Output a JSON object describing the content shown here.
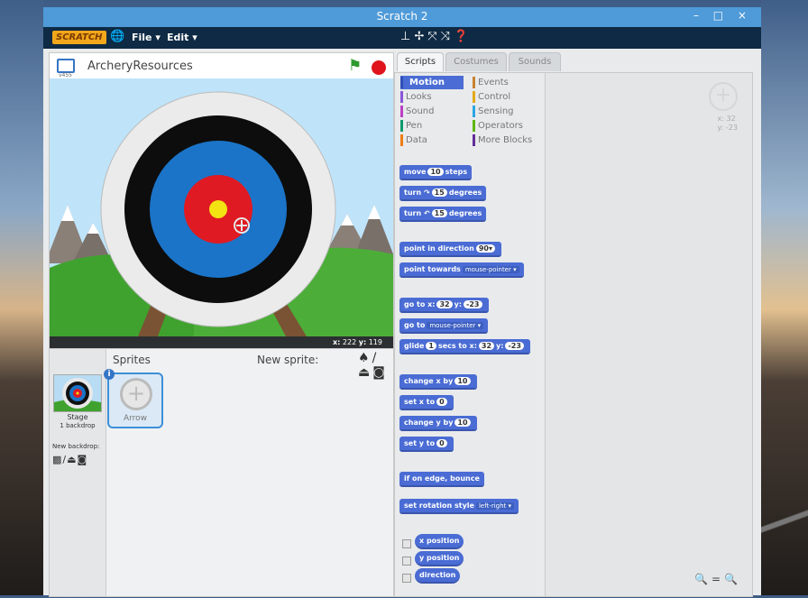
{
  "window": {
    "title": "Scratch 2",
    "controls": "– □ ×"
  },
  "menubar": {
    "logo": "SCRATCH",
    "globe_icon": "globe-icon",
    "file_label": "File ▾",
    "edit_label": "Edit ▾",
    "tools_icons": [
      "duplicate-icon",
      "delete-icon",
      "grow-icon",
      "shrink-icon",
      "help-icon"
    ]
  },
  "stage": {
    "version_label": "v455",
    "project_title": "ArcheryResources",
    "x_label": "x:",
    "x_value": "222",
    "y_label": "y:",
    "y_value": "119"
  },
  "sprites": {
    "title": "Sprites",
    "new_sprite_label": "New sprite:",
    "stage_label": "Stage",
    "stage_sub": "1 backdrop",
    "new_backdrop_label": "New backdrop:",
    "sprite_list": [
      {
        "name": "Arrow"
      }
    ]
  },
  "tabs": [
    "Scripts",
    "Costumes",
    "Sounds"
  ],
  "categories": [
    {
      "label": "Motion",
      "color": "#4a6cd4"
    },
    {
      "label": "Looks",
      "color": "#8a55d7"
    },
    {
      "label": "Sound",
      "color": "#bb42c3"
    },
    {
      "label": "Pen",
      "color": "#0e9a6c"
    },
    {
      "label": "Data",
      "color": "#ee7d16"
    },
    {
      "label": "Events",
      "color": "#c88330"
    },
    {
      "label": "Control",
      "color": "#e1a91a"
    },
    {
      "label": "Sensing",
      "color": "#2ca5e2"
    },
    {
      "label": "Operators",
      "color": "#5cb712"
    },
    {
      "label": "More Blocks",
      "color": "#632d99"
    }
  ],
  "blocks": {
    "move": {
      "a": "move",
      "n": "10",
      "b": "steps"
    },
    "turn_right": {
      "a": "turn",
      "n": "15",
      "b": "degrees"
    },
    "turn_left": {
      "a": "turn",
      "n": "15",
      "b": "degrees"
    },
    "point_direction": {
      "a": "point in direction",
      "n": "90▾"
    },
    "point_towards": {
      "a": "point towards",
      "d": "mouse-pointer ▾"
    },
    "go_to_xy": {
      "a": "go to x:",
      "n1": "32",
      "b": "y:",
      "n2": "-23"
    },
    "go_to": {
      "a": "go to",
      "d": "mouse-pointer ▾"
    },
    "glide": {
      "a": "glide",
      "n1": "1",
      "b": "secs to x:",
      "n2": "32",
      "c": "y:",
      "n3": "-23"
    },
    "change_x": {
      "a": "change x by",
      "n": "10"
    },
    "set_x": {
      "a": "set x to",
      "n": "0"
    },
    "change_y": {
      "a": "change y by",
      "n": "10"
    },
    "set_y": {
      "a": "set y to",
      "n": "0"
    },
    "bounce": {
      "a": "if on edge, bounce"
    },
    "rotation_style": {
      "a": "set rotation style",
      "d": "left-right ▾"
    },
    "x_position": "x position",
    "y_position": "y position",
    "direction": "direction"
  },
  "script_area": {
    "x_label": "x: 32",
    "y_label": "y: -23",
    "zoom_icons": [
      "zoom-out-icon",
      "zoom-reset-icon",
      "zoom-in-icon"
    ]
  }
}
